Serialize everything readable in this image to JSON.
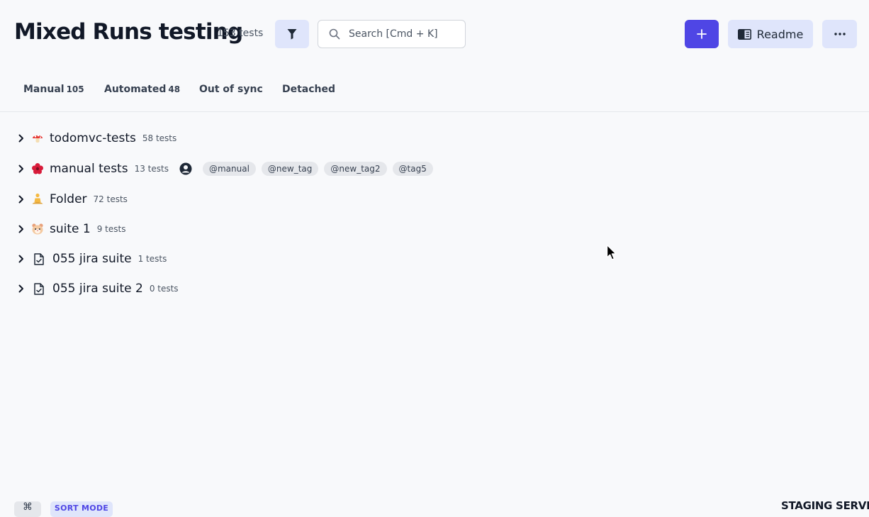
{
  "header": {
    "title": "Mixed Runs testing",
    "test_count": "153 tests",
    "search_placeholder": "Search [Cmd + K]",
    "readme_label": "Readme"
  },
  "tabs": [
    {
      "label": "Manual",
      "count": "105"
    },
    {
      "label": "Automated",
      "count": "48"
    },
    {
      "label": "Out of sync",
      "count": ""
    },
    {
      "label": "Detached",
      "count": ""
    }
  ],
  "suites": [
    {
      "name": "todomvc-tests",
      "count": "58 tests",
      "icon": "mushroom-emoji"
    },
    {
      "name": "manual tests",
      "count": "13 tests",
      "icon": "flower-emoji",
      "tags": [
        "@manual",
        "@new_tag",
        "@new_tag2",
        "@tag5"
      ]
    },
    {
      "name": "Folder",
      "count": "72 tests",
      "icon": "person-meditating-emoji"
    },
    {
      "name": "suite 1",
      "count": "9 tests",
      "icon": "hamster-emoji"
    },
    {
      "name": "055 jira suite",
      "count": "1 tests",
      "icon": "checked-document-icon"
    },
    {
      "name": "055 jira suite 2",
      "count": "0 tests",
      "icon": "checked-document-icon"
    }
  ],
  "footer": {
    "cmd_symbol": "⌘",
    "sort_mode_label": "SORT MODE",
    "staging_label": "STAGING SERVER"
  },
  "colors": {
    "accent": "#4f46e5",
    "accent_light": "#dfe5fb",
    "background": "#f8f9fb"
  }
}
